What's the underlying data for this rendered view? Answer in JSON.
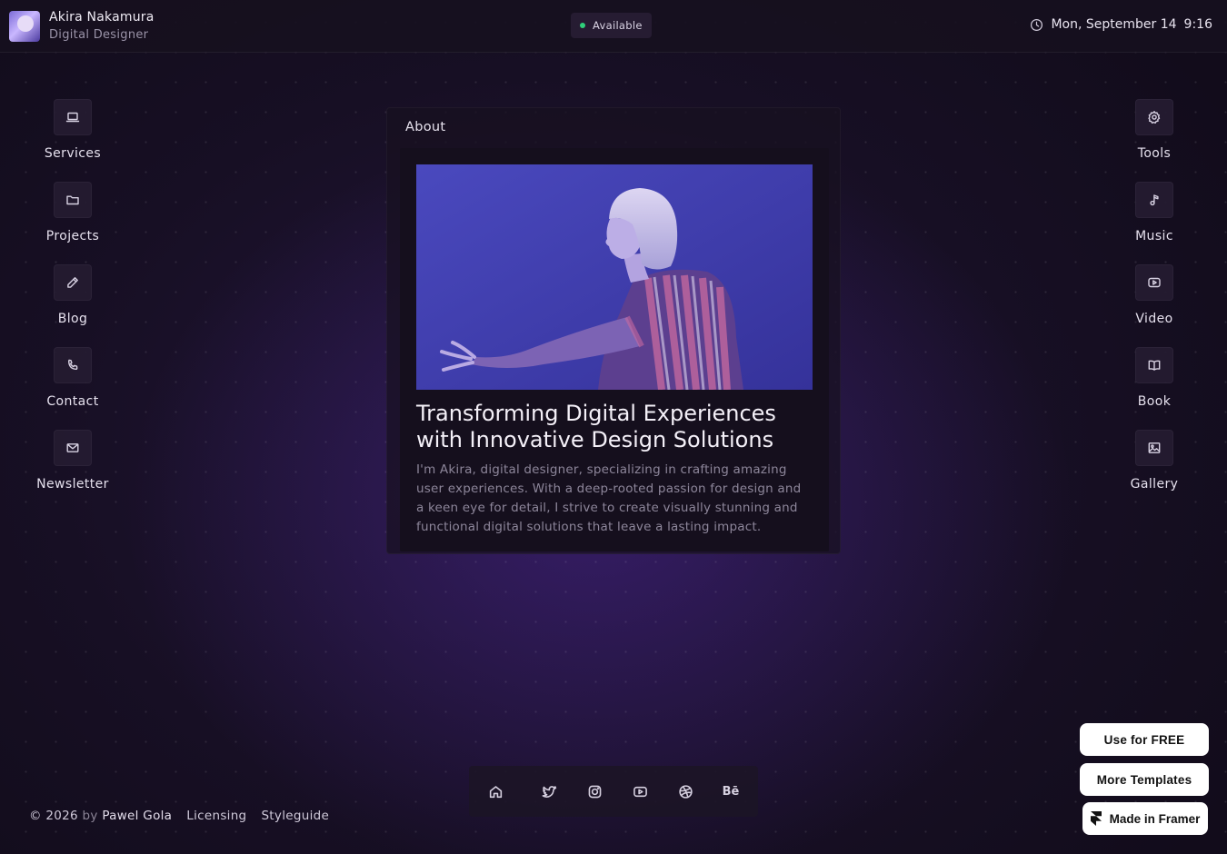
{
  "header": {
    "name": "Akira Nakamura",
    "role": "Digital Designer",
    "status": "Available",
    "status_color": "#2fd07a",
    "date": "Mon, September 14",
    "time": "9:16"
  },
  "nav_left": [
    {
      "label": "Services",
      "icon": "laptop-icon"
    },
    {
      "label": "Projects",
      "icon": "folder-icon"
    },
    {
      "label": "Blog",
      "icon": "pencil-icon"
    },
    {
      "label": "Contact",
      "icon": "phone-icon"
    },
    {
      "label": "Newsletter",
      "icon": "mail-icon"
    }
  ],
  "nav_right": [
    {
      "label": "Tools",
      "icon": "gear-icon"
    },
    {
      "label": "Music",
      "icon": "music-note-icon"
    },
    {
      "label": "Video",
      "icon": "play-icon"
    },
    {
      "label": "Book",
      "icon": "book-icon"
    },
    {
      "label": "Gallery",
      "icon": "image-icon"
    }
  ],
  "about": {
    "window_title": "About",
    "headline": "Transforming Digital Experiences with Innovative Design Solutions",
    "paragraph": "I'm Akira, digital designer, specializing in crafting amazing user experiences. With a deep-rooted passion for design and a keen eye for detail, I strive to create visually stunning and functional digital solutions that leave a lasting impact."
  },
  "social": [
    "home-icon",
    "twitter-icon",
    "instagram-icon",
    "youtube-icon",
    "dribbble-icon",
    "behance-icon"
  ],
  "social_behance_text": "Bē",
  "footer": {
    "copyright": "© 2026",
    "by": "by",
    "author": "Pawel Gola",
    "links": [
      "Licensing",
      "Styleguide"
    ]
  },
  "promo": {
    "use_free": "Use for FREE",
    "more_templates": "More Templates",
    "made_in_framer": "Made in Framer"
  }
}
